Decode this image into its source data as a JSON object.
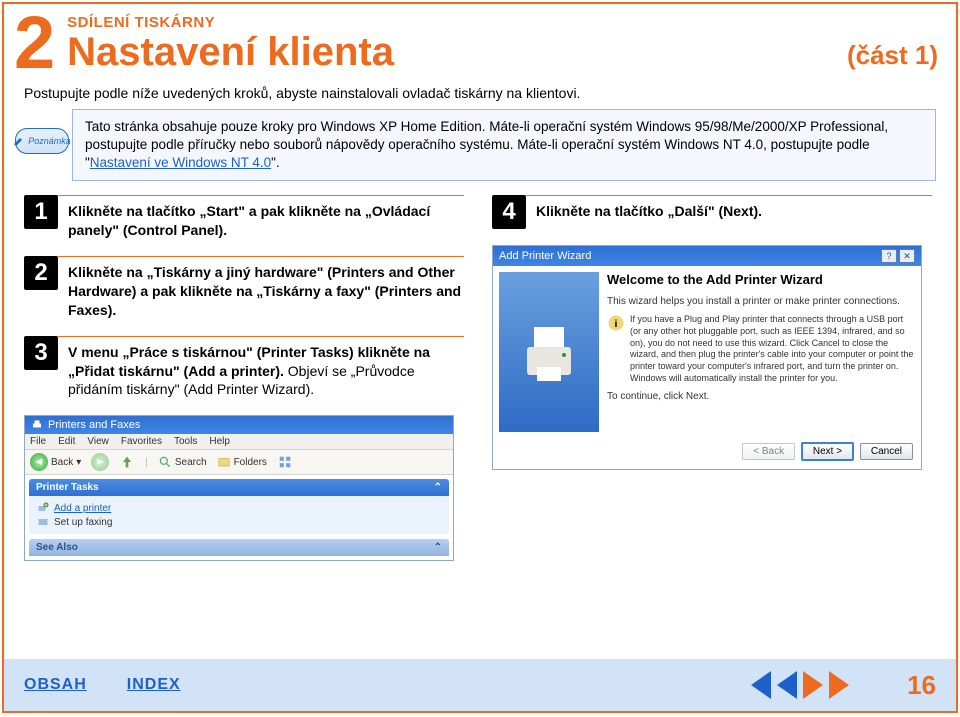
{
  "header": {
    "chapter_number": "2",
    "supertitle": "SDÍLENÍ TISKÁRNY",
    "title": "Nastavení klienta",
    "part": "(část 1)"
  },
  "subtitle": "Postupujte podle níže uvedených kroků, abyste nainstalovali ovladač tiskárny na klientovi.",
  "note": {
    "badge_label": "Poznámka",
    "text_a": "Tato stránka obsahuje pouze kroky pro Windows XP Home Edition. Máte-li operační systém Windows 95/98/Me/2000/XP Professional, postupujte podle příručky nebo souborů nápovědy operačního systému. Máte-li operační systém Windows NT 4.0, postupujte podle \"",
    "link": "Nastavení ve Windows NT 4.0",
    "text_b": "\"."
  },
  "steps_left": [
    {
      "num": "1",
      "bold": "Klikněte na tlačítko „Start\" a pak klikněte na „Ovládací panely\" (Control Panel)."
    },
    {
      "num": "2",
      "bold": "Klikněte na „Tiskárny a jiný hardware\" (Printers and Other Hardware) a pak klikněte na „Tiskárny a faxy\" (Printers and Faxes)."
    },
    {
      "num": "3",
      "bold": "V menu „Práce s tiskárnou\" (Printer Tasks) klikněte na „Přidat tiskárnu\" (Add a printer).",
      "plain": " Objeví se „Průvodce přidáním tiskárny\" (Add Printer Wizard)."
    }
  ],
  "step_right": {
    "num": "4",
    "bold": "Klikněte na tlačítko „Další\" (Next)."
  },
  "wizard": {
    "title": "Add Printer Wizard",
    "heading": "Welcome to the Add Printer Wizard",
    "p1": "This wizard helps you install a printer or make printer connections.",
    "p2": "If you have a Plug and Play printer that connects through a USB port (or any other hot pluggable port, such as IEEE 1394, infrared, and so on), you do not need to use this wizard. Click Cancel to close the wizard, and then plug the printer's cable into your computer or point the printer toward your computer's infrared port, and turn the printer on. Windows will automatically install the printer for you.",
    "p3": "To continue, click Next.",
    "btn_back": "< Back",
    "btn_next": "Next >",
    "btn_cancel": "Cancel"
  },
  "explorer": {
    "title": "Printers and Faxes",
    "menu": [
      "File",
      "Edit",
      "View",
      "Favorites",
      "Tools",
      "Help"
    ],
    "toolbar": {
      "back": "Back",
      "search": "Search",
      "folders": "Folders"
    },
    "panel1_title": "Printer Tasks",
    "panel1_items": [
      "Add a printer",
      "Set up faxing"
    ],
    "panel2_title": "See Also"
  },
  "footer": {
    "link_contents": "OBSAH",
    "link_index": "INDEX",
    "page_number": "16"
  }
}
